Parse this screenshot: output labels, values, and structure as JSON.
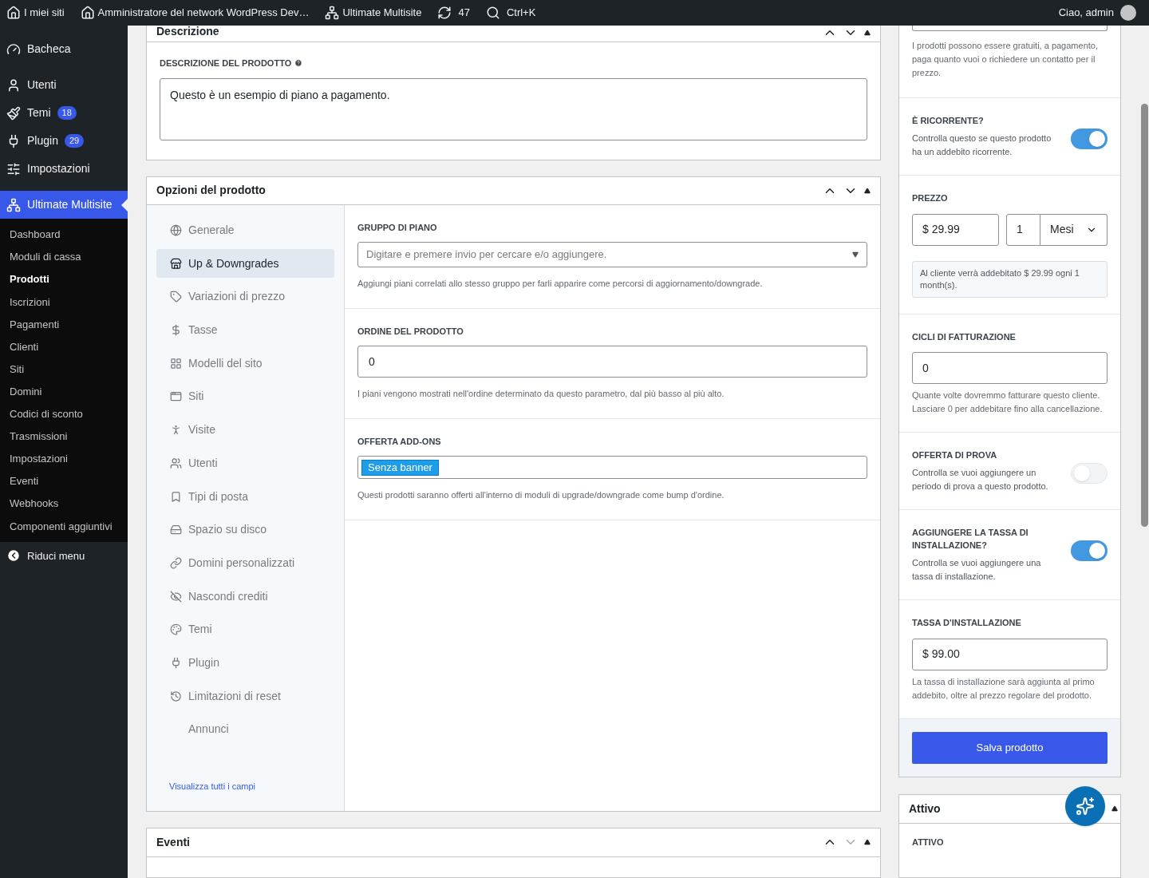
{
  "admin_bar": {
    "my_sites": "I miei siti",
    "site_name": "Amministratore del network WordPress Dev…",
    "plugin": "Ultimate Multisite",
    "updates": "47",
    "search": "Ctrl+K",
    "greeting": "Ciao, admin"
  },
  "sidebar": {
    "items": [
      {
        "label": "Bacheca",
        "selected": false
      },
      {
        "label": "Utenti",
        "selected": false
      },
      {
        "label": "Temi",
        "badge": "18",
        "selected": false
      },
      {
        "label": "Plugin",
        "badge": "29",
        "selected": false
      },
      {
        "label": "Impostazioni",
        "selected": false
      },
      {
        "label": "Ultimate Multisite",
        "selected": true
      }
    ],
    "submenu": [
      {
        "label": "Dashboard",
        "selected": false
      },
      {
        "label": "Moduli di cassa",
        "selected": false
      },
      {
        "label": "Prodotti",
        "selected": true
      },
      {
        "label": "Iscrizioni",
        "selected": false
      },
      {
        "label": "Pagamenti",
        "selected": false
      },
      {
        "label": "Clienti",
        "selected": false
      },
      {
        "label": "Siti",
        "selected": false
      },
      {
        "label": "Domini",
        "selected": false
      },
      {
        "label": "Codici di sconto",
        "selected": false
      },
      {
        "label": "Trasmissioni",
        "selected": false
      },
      {
        "label": "Impostazioni",
        "selected": false
      },
      {
        "label": "Eventi",
        "selected": false
      },
      {
        "label": "Webhooks",
        "selected": false
      },
      {
        "label": "Componenti aggiuntivi",
        "selected": false
      }
    ],
    "collapse": "Riduci menu"
  },
  "description_panel": {
    "title": "Descrizione",
    "label": "DESCRIZIONE DEL PRODOTTO",
    "value": "Questo è un esempio di piano a pagamento."
  },
  "options_panel": {
    "title": "Opzioni del prodotto",
    "tabs": [
      {
        "label": "Generale",
        "selected": false
      },
      {
        "label": "Up & Downgrades",
        "selected": true
      },
      {
        "label": "Variazioni di prezzo",
        "selected": false
      },
      {
        "label": "Tasse",
        "selected": false
      },
      {
        "label": "Modelli del sito",
        "selected": false
      },
      {
        "label": "Siti",
        "selected": false
      },
      {
        "label": "Visite",
        "selected": false
      },
      {
        "label": "Utenti",
        "selected": false
      },
      {
        "label": "Tipi di posta",
        "selected": false
      },
      {
        "label": "Spazio su disco",
        "selected": false
      },
      {
        "label": "Domini personalizzati",
        "selected": false
      },
      {
        "label": "Nascondi crediti",
        "selected": false
      },
      {
        "label": "Temi",
        "selected": false
      },
      {
        "label": "Plugin",
        "selected": false
      },
      {
        "label": "Limitazioni di reset",
        "selected": false
      },
      {
        "label": "Annunci",
        "selected": false
      }
    ],
    "show_all": "Visualizza tutti i campi",
    "fields": [
      {
        "kind": "select",
        "label": "GRUPPO DI PIANO",
        "placeholder": "Digitare e premere invio per cercare e/o aggiungere.",
        "help": "Aggiungi piani correlati allo stesso gruppo per farli apparire come percorsi di aggiornamento/downgrade."
      },
      {
        "kind": "input",
        "label": "ORDINE DEL PRODOTTO",
        "value": "0",
        "help": "I piani vengono mostrati nell'ordine determinato da questo parametro, dal più basso al più alto."
      },
      {
        "kind": "tags",
        "label": "OFFERTA ADD-ONS",
        "tags": [
          "Senza banner"
        ],
        "help": "Questi prodotti saranno offerti all'interno di moduli di upgrade/downgrade come bump d'ordine."
      }
    ]
  },
  "events_panel": {
    "title": "Eventi"
  },
  "pricing_panel": {
    "type_help": "I prodotti possono essere gratuiti, a pagamento, paga quanto vuoi o richiedere un contatto per il prezzo.",
    "sections": [
      {
        "kind": "toggle",
        "label": "È RICORRENTE?",
        "help": "Controlla questo se questo prodotto ha un addebito ricorrente.",
        "on": true
      },
      {
        "kind": "price",
        "label": "PREZZO",
        "amount": "$ 29.99",
        "interval": "1",
        "unit": "Mesi",
        "note": "Al cliente verrà addebitato $ 29.99 ogni 1 month(s)."
      },
      {
        "kind": "input",
        "label": "CICLI DI FATTURAZIONE",
        "value": "0",
        "help": "Quante volte dovremmo fatturare questo cliente. Lasciare 0 per addebitare fino alla cancellazione."
      },
      {
        "kind": "toggle",
        "label": "OFFERTA DI PROVA",
        "help": "Controlla se vuoi aggiungere un periodo di prova a questo prodotto.",
        "on": false
      },
      {
        "kind": "toggle",
        "label": "AGGIUNGERE LA TASSA DI INSTALLAZIONE?",
        "help": "Controlla se vuoi aggiungere una tassa di installazione.",
        "on": true
      },
      {
        "kind": "input",
        "label": "TASSA D'INSTALLAZIONE",
        "value": "$ 99.00",
        "help": "La tassa di installazione sarà aggiunta al primo addebito, oltre al prezzo regolare del prodotto."
      }
    ],
    "save": "Salva prodotto"
  },
  "active_panel": {
    "title": "Attivo",
    "label": "ATTIVO"
  }
}
